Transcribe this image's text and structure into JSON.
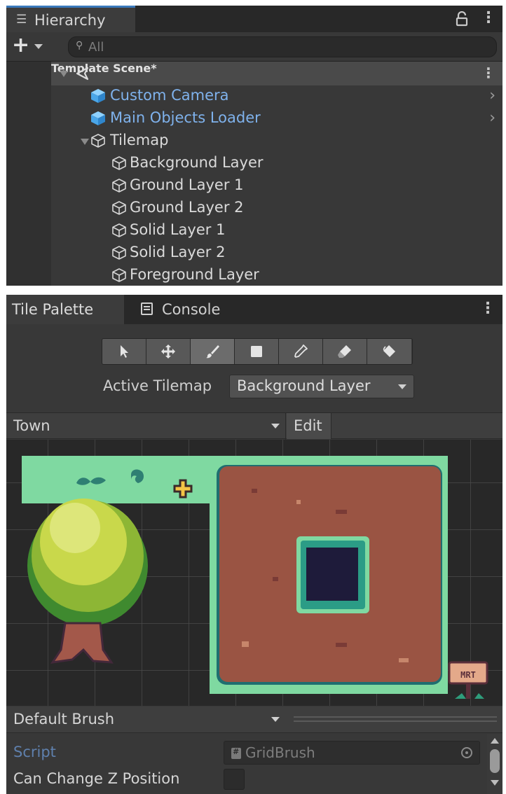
{
  "colors": {
    "panel_bg": "#383838",
    "tab_accent": "#3a79bb",
    "prefab_blue": "#7fb2ec",
    "grid_bg": "#282828",
    "grass": "#7fd9a1",
    "dirt": "#9a5443",
    "tree_leaves": "#c9d84b"
  },
  "hierarchy": {
    "tab_label": "Hierarchy",
    "tab_icon": "list-icon",
    "search": {
      "placeholder": "All",
      "value": ""
    },
    "scene": {
      "label": "Template Scene*",
      "icon": "unity-scene-icon"
    },
    "items": [
      {
        "label": "Custom Camera",
        "icon": "prefab-cube-icon",
        "prefab": true,
        "has_children_arrow": true
      },
      {
        "label": "Main Objects Loader",
        "icon": "prefab-cube-icon",
        "prefab": true,
        "has_children_arrow": true
      },
      {
        "label": "Tilemap",
        "icon": "gameobject-cube-icon",
        "expanded": true
      },
      {
        "label": "Background Layer",
        "icon": "gameobject-cube-icon"
      },
      {
        "label": "Ground Layer 1",
        "icon": "gameobject-cube-icon"
      },
      {
        "label": "Ground Layer 2",
        "icon": "gameobject-cube-icon"
      },
      {
        "label": "Solid Layer 1",
        "icon": "gameobject-cube-icon"
      },
      {
        "label": "Solid Layer 2",
        "icon": "gameobject-cube-icon"
      },
      {
        "label": "Foreground Layer",
        "icon": "gameobject-cube-icon"
      }
    ]
  },
  "palette": {
    "tabs": [
      {
        "label": "Tile Palette",
        "active": true
      },
      {
        "label": "Console",
        "icon": "console-icon",
        "active": false
      }
    ],
    "tools": [
      {
        "name": "select-tool",
        "active": false
      },
      {
        "name": "move-tool",
        "active": false
      },
      {
        "name": "paint-brush-tool",
        "active": true
      },
      {
        "name": "box-fill-tool",
        "active": false
      },
      {
        "name": "picker-tool",
        "active": false
      },
      {
        "name": "eraser-tool",
        "active": false
      },
      {
        "name": "flood-fill-tool",
        "active": false
      }
    ],
    "active_tilemap_label": "Active Tilemap",
    "active_tilemap_value": "Background Layer",
    "palette_name": "Town",
    "edit_label": "Edit",
    "sign_text": "MRT",
    "brush_name": "Default Brush",
    "properties": {
      "script_label": "Script",
      "script_value": "GridBrush",
      "can_change_z_label": "Can Change Z Position",
      "can_change_z_checked": false
    }
  }
}
